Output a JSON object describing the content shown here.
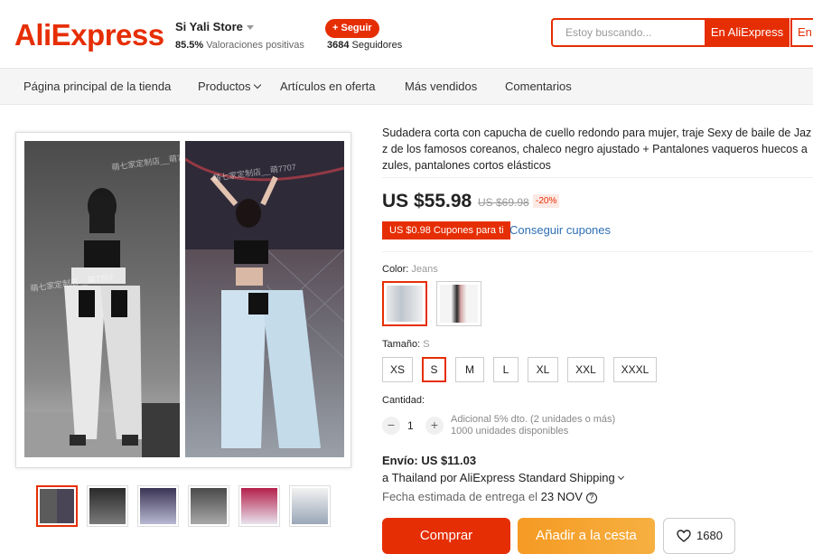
{
  "header": {
    "logo": "AliExpress",
    "store_name": "Si Yali Store",
    "rating_value": "85.5%",
    "rating_label": "Valoraciones positivas",
    "follow_label": "+ Seguir",
    "followers_count": "3684",
    "followers_label": "Seguidores",
    "search_placeholder": "Estoy buscando...",
    "search_ali_label": "En AliExpress",
    "search_store_label": "En esta tienda"
  },
  "nav": {
    "items": [
      "Página principal de la tienda",
      "Productos",
      "Artículos en oferta",
      "Más vendidos",
      "Comentarios"
    ]
  },
  "gallery": {
    "watermark": "萌七家定制店__萌7707",
    "thumb_count": 6
  },
  "product": {
    "title": "Sudadera corta con capucha de cuello redondo para mujer, traje Sexy de baile de Jaz z de los famosos coreanos, chaleco negro ajustado + Pantalones vaqueros huecos a zules, pantalones cortos elásticos",
    "price": "US $55.98",
    "old_price": "US $69.98",
    "discount": "-20%",
    "coupon_badge": "US $0.98 Cupones para ti",
    "coupon_link": "Conseguir cupones",
    "color_label": "Color:",
    "color_value": "Jeans",
    "size_label": "Tamaño:",
    "size_value": "S",
    "sizes": [
      "XS",
      "S",
      "M",
      "L",
      "XL",
      "XXL",
      "XXXL"
    ],
    "quantity_label": "Cantidad:",
    "quantity": "1",
    "qty_minus": "−",
    "qty_plus": "+",
    "qty_note_1": "Adicional 5% dto. (2 unidades o más)",
    "qty_note_2": "1000 unidades disponibles"
  },
  "shipping": {
    "label": "Envío: US $11.03",
    "route": "a Thailand por AliExpress Standard Shipping",
    "eta_label": "Fecha estimada de entrega el",
    "eta_date": "23 NOV",
    "help_glyph": "?"
  },
  "actions": {
    "buy_label": "Comprar",
    "cart_label": "Añadir a la cesta",
    "wish_count": "1680"
  },
  "colors": {
    "accent": "#e62e04",
    "cart": "#f5a623",
    "link": "#2e6fb6"
  }
}
